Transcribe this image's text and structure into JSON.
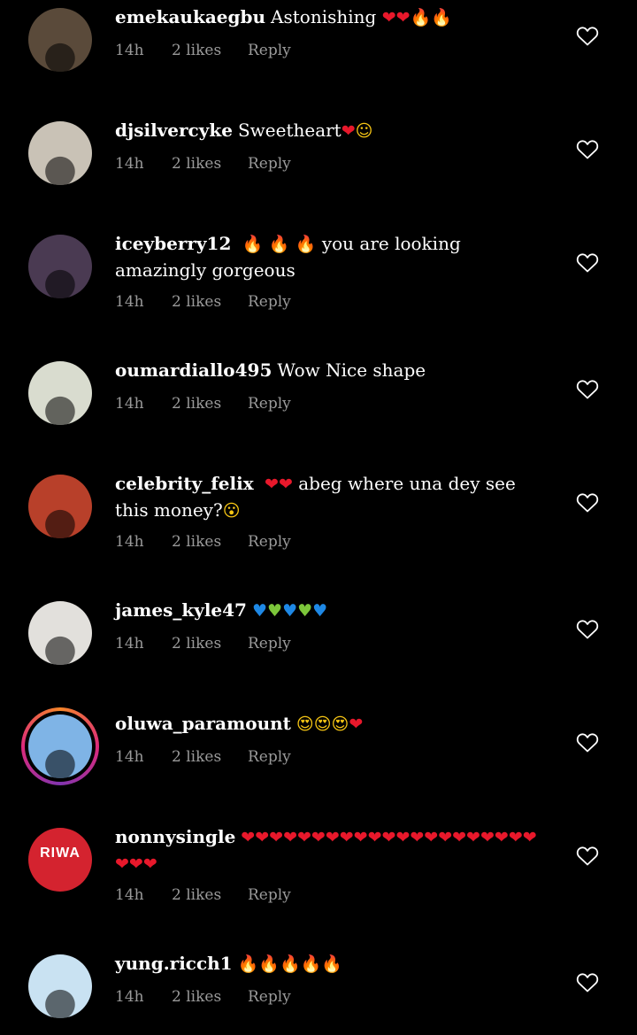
{
  "comments": [
    {
      "username": "emekaukaegbu",
      "text": "Astonishing",
      "emojis": [
        "heart",
        "heart",
        "fire",
        "fire"
      ],
      "time": "14h",
      "likes": "2 likes",
      "reply": "Reply",
      "avatar_color": "#5a4a3a",
      "has_story": false
    },
    {
      "username": "djsilvercyke",
      "text": "Sweetheart",
      "emojis": [
        "heart",
        "smile"
      ],
      "time": "14h",
      "likes": "2 likes",
      "reply": "Reply",
      "avatar_color": "#c9c2b6",
      "has_story": false
    },
    {
      "username": "iceyberry12",
      "text_prefix_emojis": [
        "fire",
        "fire",
        "fire"
      ],
      "text": "you are looking amazingly gorgeous",
      "time": "14h",
      "likes": "2 likes",
      "reply": "Reply",
      "avatar_color": "#4a3a52",
      "has_story": false
    },
    {
      "username": "oumardiallo495",
      "text": "Wow Nice shape",
      "time": "14h",
      "likes": "2 likes",
      "reply": "Reply",
      "avatar_color": "#d9dccf",
      "has_story": false
    },
    {
      "username": "celebrity_felix",
      "text_prefix_emojis": [
        "heart",
        "heart"
      ],
      "text": "abeg where una dey see this money?",
      "emojis": [
        "surprised"
      ],
      "time": "14h",
      "likes": "2 likes",
      "reply": "Reply",
      "avatar_color": "#b8402a",
      "has_story": false
    },
    {
      "username": "james_kyle47",
      "emojis": [
        "blue",
        "green",
        "blue",
        "green",
        "blue"
      ],
      "time": "14h",
      "likes": "2 likes",
      "reply": "Reply",
      "avatar_color": "#e2e0dc",
      "has_story": false
    },
    {
      "username": "oluwa_paramount",
      "emojis": [
        "hearteyes",
        "hearteyes",
        "hearteyes",
        "heart"
      ],
      "time": "14h",
      "likes": "2 likes",
      "reply": "Reply",
      "avatar_color": "#7fb4e6",
      "has_story": true
    },
    {
      "username": "nonnysingle",
      "emoji_heart_count": 24,
      "time": "14h",
      "likes": "2 likes",
      "reply": "Reply",
      "avatar_color": "#d4232f",
      "avatar_text": "RIWA",
      "has_story": false
    },
    {
      "username": "yung.ricch1",
      "emojis": [
        "fire",
        "fire",
        "fire",
        "fire",
        "fire"
      ],
      "time": "14h",
      "likes": "2 likes",
      "reply": "Reply",
      "avatar_color": "#c9e2f2",
      "has_story": false
    }
  ],
  "glyphs": {
    "heart": "❤",
    "fire": "🔥",
    "smile": "☺",
    "surprised": "😮",
    "blue": "♥",
    "green": "♥",
    "hearteyes": "😍"
  },
  "colors": {
    "background": "#000000",
    "text": "#ffffff",
    "meta": "#9a9a9a",
    "heart": "#e8182b"
  }
}
